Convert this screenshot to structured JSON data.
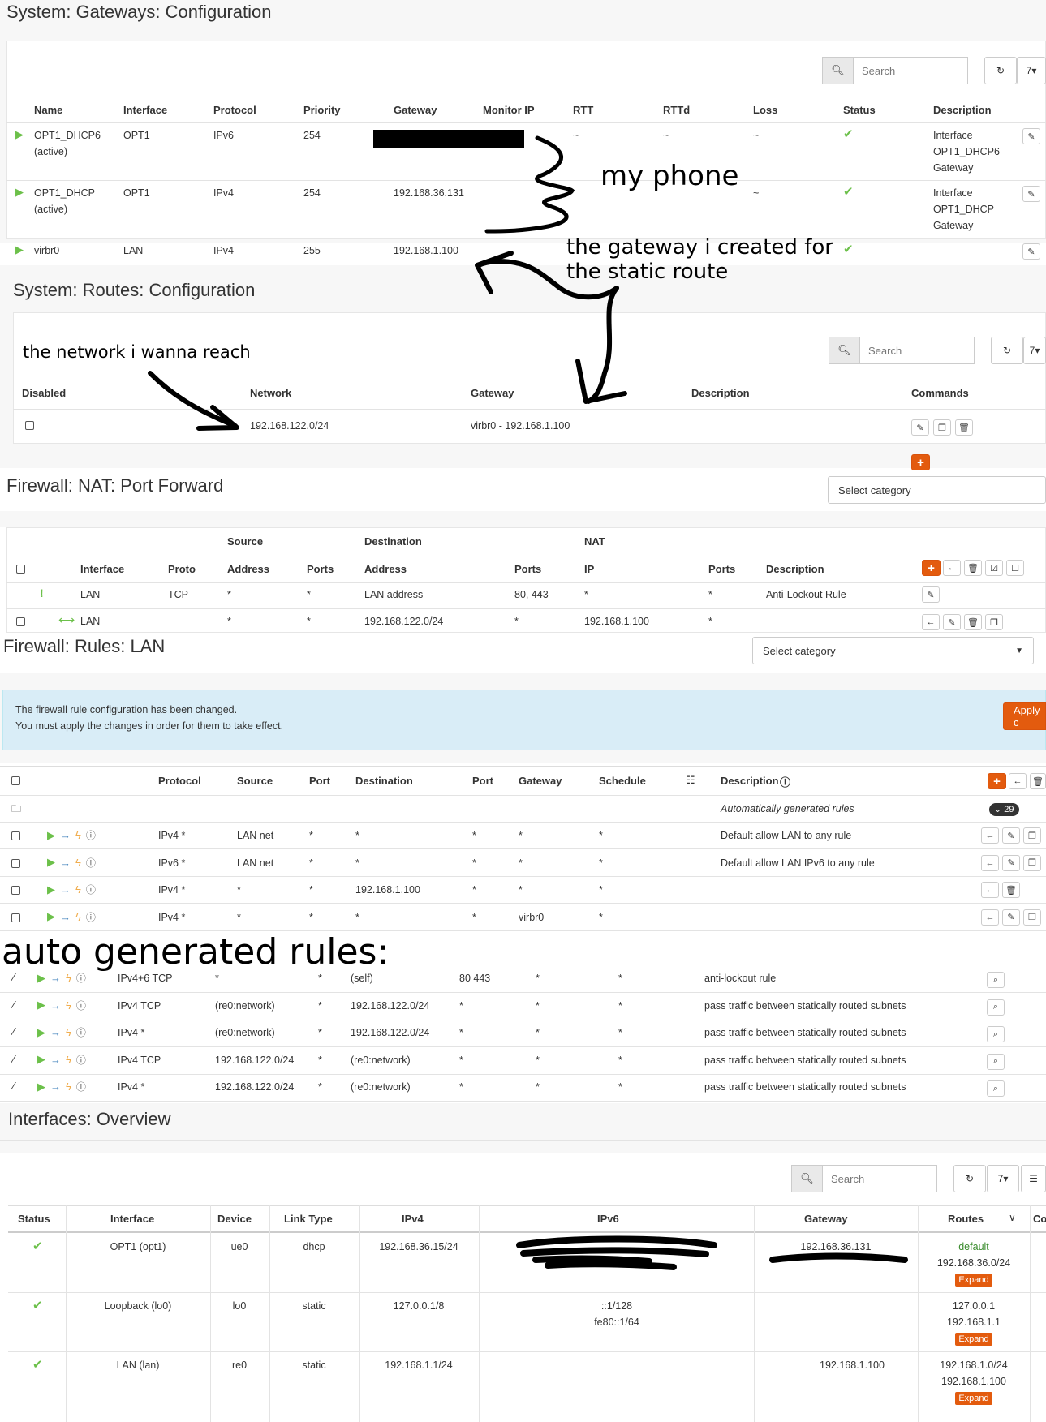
{
  "gateways": {
    "title": "System: Gateways: Configuration",
    "search_placeholder": "Search",
    "page_size": "7",
    "columns": [
      "Name",
      "Interface",
      "Protocol",
      "Priority",
      "Gateway",
      "Monitor IP",
      "RTT",
      "RTTd",
      "Loss",
      "Status",
      "Description"
    ],
    "rows": [
      {
        "name": "OPT1_DHCP6",
        "state": "(active)",
        "interface": "OPT1",
        "protocol": "IPv6",
        "priority": "254",
        "gateway": "",
        "rtt": "~",
        "rttd": "~",
        "loss": "~",
        "desc1": "Interface",
        "desc2": "OPT1_DHCP6",
        "desc3": "Gateway"
      },
      {
        "name": "OPT1_DHCP",
        "state": "(active)",
        "interface": "OPT1",
        "protocol": "IPv4",
        "priority": "254",
        "gateway": "192.168.36.131",
        "rtt": "",
        "rttd": "",
        "loss": "~",
        "desc1": "Interface",
        "desc2": "OPT1_DHCP",
        "desc3": "Gateway"
      },
      {
        "name": "virbr0",
        "state": "",
        "interface": "LAN",
        "protocol": "IPv4",
        "priority": "255",
        "gateway": "192.168.1.100",
        "rtt": "",
        "rttd": "",
        "loss": "",
        "desc1": "",
        "desc2": "",
        "desc3": ""
      }
    ]
  },
  "routes": {
    "title": "System: Routes: Configuration",
    "search_placeholder": "Search",
    "page_size": "7",
    "columns": [
      "Disabled",
      "Network",
      "Gateway",
      "Description",
      "Commands"
    ],
    "row": {
      "network": "192.168.122.0/24",
      "gateway": "virbr0 - 192.168.1.100"
    }
  },
  "nat": {
    "title": "Firewall: NAT: Port Forward",
    "select_category": "Select category",
    "group_headers": [
      "Source",
      "Destination",
      "NAT"
    ],
    "columns": [
      "Interface",
      "Proto",
      "Address",
      "Ports",
      "Address",
      "Ports",
      "IP",
      "Ports",
      "Description"
    ],
    "rows": [
      {
        "interface": "LAN",
        "proto": "TCP",
        "src_addr": "*",
        "src_ports": "*",
        "dst_addr": "LAN address",
        "dst_ports": "80, 443",
        "ip": "*",
        "ports": "*",
        "desc": "Anti-Lockout Rule"
      },
      {
        "interface": "LAN",
        "proto": "",
        "src_addr": "*",
        "src_ports": "*",
        "dst_addr": "192.168.122.0/24",
        "dst_ports": "*",
        "ip": "192.168.1.100",
        "ports": "*",
        "desc": ""
      }
    ]
  },
  "rules": {
    "title": "Firewall: Rules: LAN",
    "select_category": "Select category",
    "alert_line1": "The firewall rule configuration has been changed.",
    "alert_line2": "You must apply the changes in order for them to take effect.",
    "apply_label": "Apply c",
    "columns": [
      "Protocol",
      "Source",
      "Port",
      "Destination",
      "Port",
      "Gateway",
      "Schedule",
      "Description"
    ],
    "auto_label": "Automatically generated rules",
    "auto_count": "29",
    "rows": [
      {
        "protocol": "IPv4 *",
        "source": "LAN net",
        "port": "*",
        "destination": "*",
        "dport": "*",
        "gateway": "*",
        "schedule": "*",
        "desc": "Default allow LAN to any rule"
      },
      {
        "protocol": "IPv6 *",
        "source": "LAN net",
        "port": "*",
        "destination": "*",
        "dport": "*",
        "gateway": "*",
        "schedule": "*",
        "desc": "Default allow LAN IPv6 to any rule"
      },
      {
        "protocol": "IPv4 *",
        "source": "*",
        "port": "*",
        "destination": "192.168.1.100",
        "dport": "*",
        "gateway": "*",
        "schedule": "*",
        "desc": ""
      },
      {
        "protocol": "IPv4 *",
        "source": "*",
        "port": "*",
        "destination": "*",
        "dport": "*",
        "gateway": "virbr0",
        "schedule": "*",
        "desc": ""
      }
    ]
  },
  "auto_rules": {
    "title": "auto generated rules:",
    "rows": [
      {
        "protocol": "IPv4+6 TCP",
        "source": "*",
        "port": "*",
        "destination": "(self)",
        "dport": "80 443",
        "gateway": "*",
        "schedule": "*",
        "desc": "anti-lockout rule"
      },
      {
        "protocol": "IPv4 TCP",
        "source": "(re0:network)",
        "port": "*",
        "destination": "192.168.122.0/24",
        "dport": "*",
        "gateway": "*",
        "schedule": "*",
        "desc": "pass traffic between statically routed subnets"
      },
      {
        "protocol": "IPv4 *",
        "source": "(re0:network)",
        "port": "*",
        "destination": "192.168.122.0/24",
        "dport": "*",
        "gateway": "*",
        "schedule": "*",
        "desc": "pass traffic between statically routed subnets"
      },
      {
        "protocol": "IPv4 TCP",
        "source": "192.168.122.0/24",
        "port": "*",
        "destination": "(re0:network)",
        "dport": "*",
        "gateway": "*",
        "schedule": "*",
        "desc": "pass traffic between statically routed subnets"
      },
      {
        "protocol": "IPv4 *",
        "source": "192.168.122.0/24",
        "port": "*",
        "destination": "(re0:network)",
        "dport": "*",
        "gateway": "*",
        "schedule": "*",
        "desc": "pass traffic between statically routed subnets"
      }
    ]
  },
  "interfaces": {
    "title": "Interfaces: Overview",
    "search_placeholder": "Search",
    "page_size": "7",
    "columns": [
      "Status",
      "Interface",
      "Device",
      "Link Type",
      "IPv4",
      "IPv6",
      "Gateway",
      "Routes",
      "Co"
    ],
    "expand_label": "Expand",
    "rows": [
      {
        "interface": "OPT1 (opt1)",
        "device": "ue0",
        "link": "dhcp",
        "ipv4": "192.168.36.15/24",
        "ipv6a": "",
        "ipv6b": "",
        "gateway": "192.168.36.131",
        "route1": "default",
        "route2": "192.168.36.0/24"
      },
      {
        "interface": "Loopback (lo0)",
        "device": "lo0",
        "link": "static",
        "ipv4": "127.0.0.1/8",
        "ipv6a": "::1/128",
        "ipv6b": "fe80::1/64",
        "gateway": "",
        "route1": "127.0.0.1",
        "route2": "192.168.1.1"
      },
      {
        "interface": "LAN (lan)",
        "device": "re0",
        "link": "static",
        "ipv4": "192.168.1.1/24",
        "ipv6a": "",
        "ipv6b": "",
        "gateway": "192.168.1.100",
        "route1": "192.168.1.0/24",
        "route2": "192.168.1.100"
      }
    ]
  },
  "annotations": {
    "phone": "my phone",
    "gateway_line1": "the gateway i created for",
    "gateway_line2": "the static route",
    "network": "the network i wanna reach"
  },
  "colors": {
    "accent": "#e35b0e",
    "status_green": "#6cc04a",
    "alert_bg": "#d9edf7"
  }
}
